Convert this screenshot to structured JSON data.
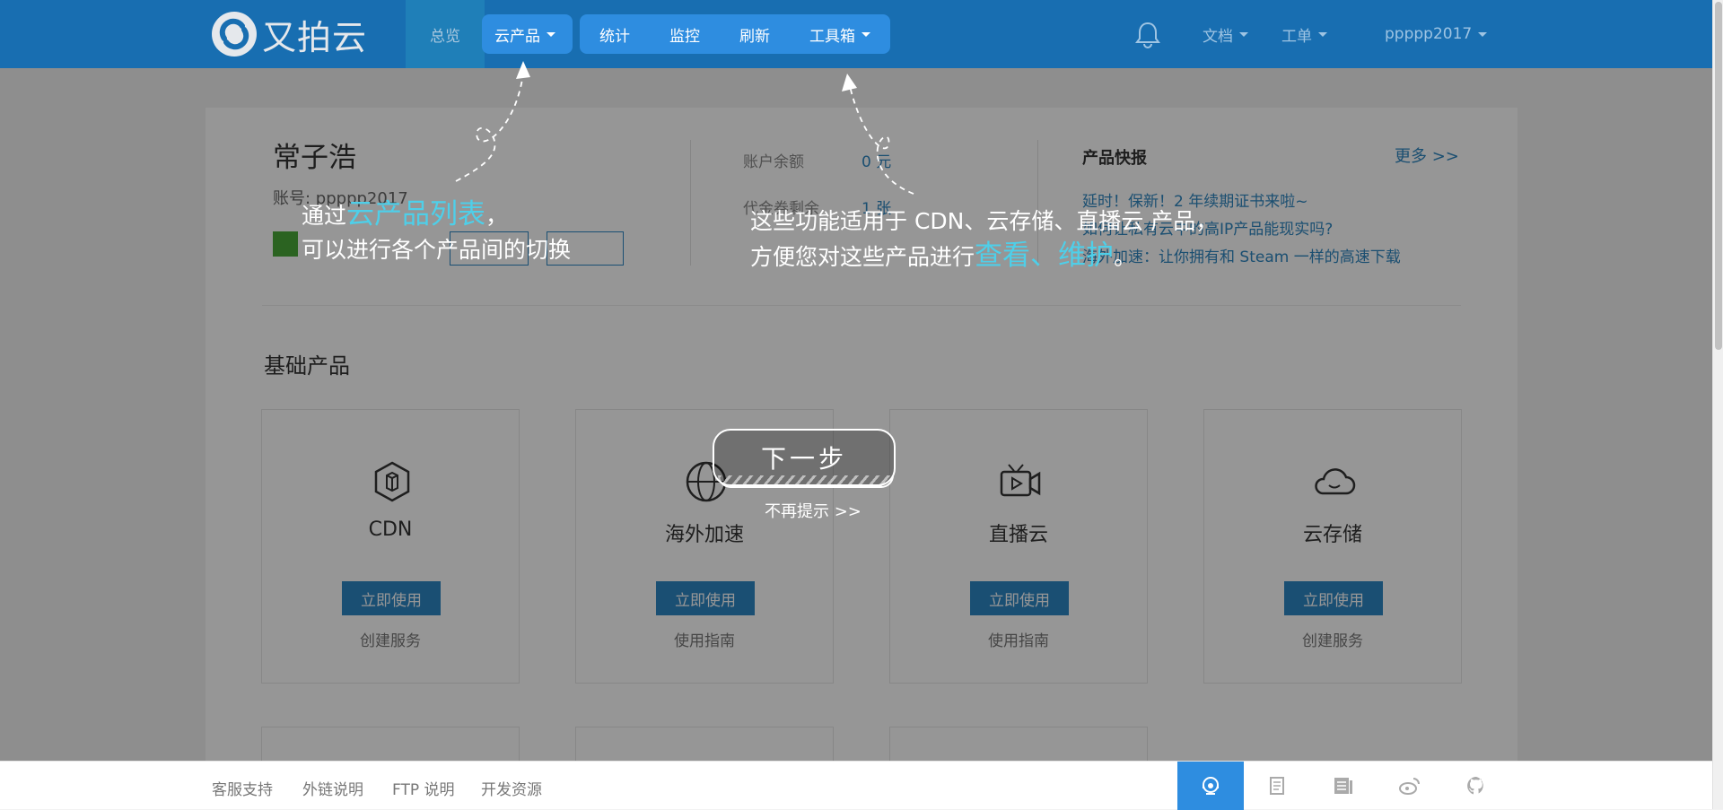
{
  "header": {
    "logo_text": "又拍云",
    "nav": {
      "overview": "总览",
      "cloud_products": "云产品",
      "tools": [
        "统计",
        "监控",
        "刷新"
      ],
      "toolbox": "工具箱"
    },
    "right": {
      "docs": "文档",
      "tickets": "工单",
      "user": "ppppp2017"
    }
  },
  "account": {
    "name": "常子浩",
    "account_label": "账号: ppppp2017",
    "balance_label": "账户余额",
    "balance_value": "0 元",
    "voucher_label": "代金券剩余",
    "voucher_value": "1 张"
  },
  "news": {
    "title": "产品快报",
    "more": "更多 >>",
    "items": [
      "延时！保新！2 年续期证书来啦~",
      "如何让私有云中的高IP产品能现实吗?",
      "海外加速：让你拥有和 Steam 一样的高速下载"
    ]
  },
  "section_title": "基础产品",
  "products": [
    {
      "name": "CDN",
      "button": "立即使用",
      "link": "创建服务",
      "icon": "cdn-icon"
    },
    {
      "name": "海外加速",
      "button": "立即使用",
      "link": "使用指南",
      "icon": "globe-icon"
    },
    {
      "name": "直播云",
      "button": "立即使用",
      "link": "使用指南",
      "icon": "live-camera-icon"
    },
    {
      "name": "云存储",
      "button": "立即使用",
      "link": "创建服务",
      "icon": "cloud-icon"
    }
  ],
  "guide": {
    "tip1_a": "通过",
    "tip1_hl": "云产品列表",
    "tip1_b": "，",
    "tip1_line2": "可以进行各个产品间的切换",
    "tip2_line1": "这些功能适用于 CDN、云存储、直播云 产品，",
    "tip2_a": "方便您对这些产品进行",
    "tip2_hl": "查看、维护",
    "tip2_b": "。",
    "next": "下一步",
    "skip": "不再提示 >>"
  },
  "footer": {
    "links": [
      "客服支持",
      "外链说明",
      "FTP 说明",
      "开发资源"
    ],
    "icons": [
      "support-icon",
      "document-icon",
      "news-icon",
      "weibo-icon",
      "github-icon"
    ]
  },
  "colors": {
    "header": "#186eb1",
    "accent": "#2e8de0",
    "highlight_text": "#4ecfe9"
  }
}
